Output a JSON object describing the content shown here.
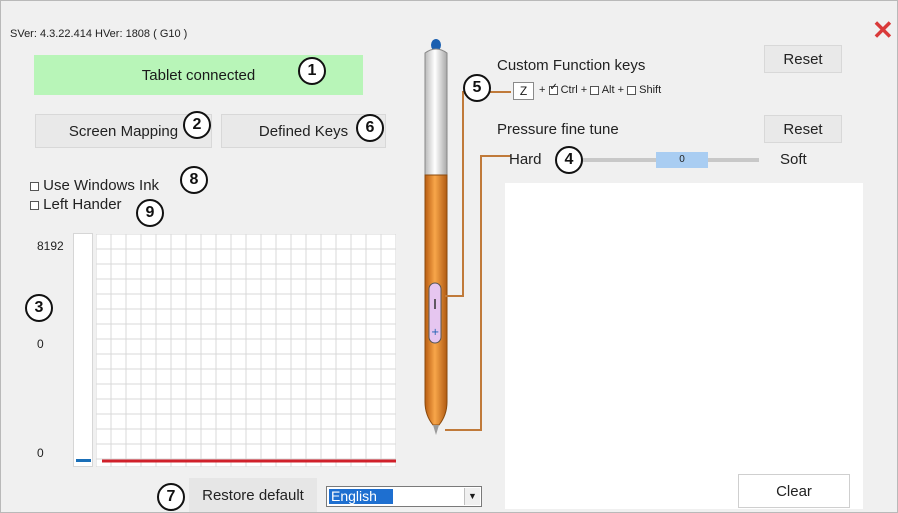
{
  "header": {
    "version_text": "SVer: 4.3.22.414  HVer: 1808  ( G10 )",
    "close_glyph": "✕"
  },
  "status": {
    "text": "Tablet connected",
    "color": "#b8f5b8"
  },
  "buttons": {
    "screen_mapping": "Screen Mapping",
    "defined_keys": "Defined Keys",
    "restore_default": "Restore default",
    "reset_function": "Reset",
    "reset_pressure": "Reset",
    "clear": "Clear"
  },
  "checkboxes": {
    "windows_ink": {
      "label": "Use Windows Ink",
      "checked": false
    },
    "left_hander": {
      "label": "Left Hander",
      "checked": false
    }
  },
  "graph": {
    "y_top": "8192",
    "y_mid": "0",
    "y_bottom": "0"
  },
  "language": {
    "selected": "English"
  },
  "custom_keys": {
    "title": "Custom Function keys",
    "key_value": "Z",
    "plus": "+",
    "ctrl": {
      "label": "Ctrl",
      "checked": true
    },
    "alt": {
      "label": "Alt",
      "checked": false
    },
    "shift": {
      "label": "Shift",
      "checked": false
    }
  },
  "pressure": {
    "title": "Pressure fine tune",
    "hard_label": "Hard",
    "soft_label": "Soft",
    "value": "0"
  },
  "callouts": [
    "1",
    "2",
    "3",
    "4",
    "5",
    "6",
    "7",
    "8",
    "9"
  ],
  "colors": {
    "accent_blue": "#1565c0",
    "pen_orange": "#e07c1f",
    "pressure_line": "#d0202a"
  }
}
